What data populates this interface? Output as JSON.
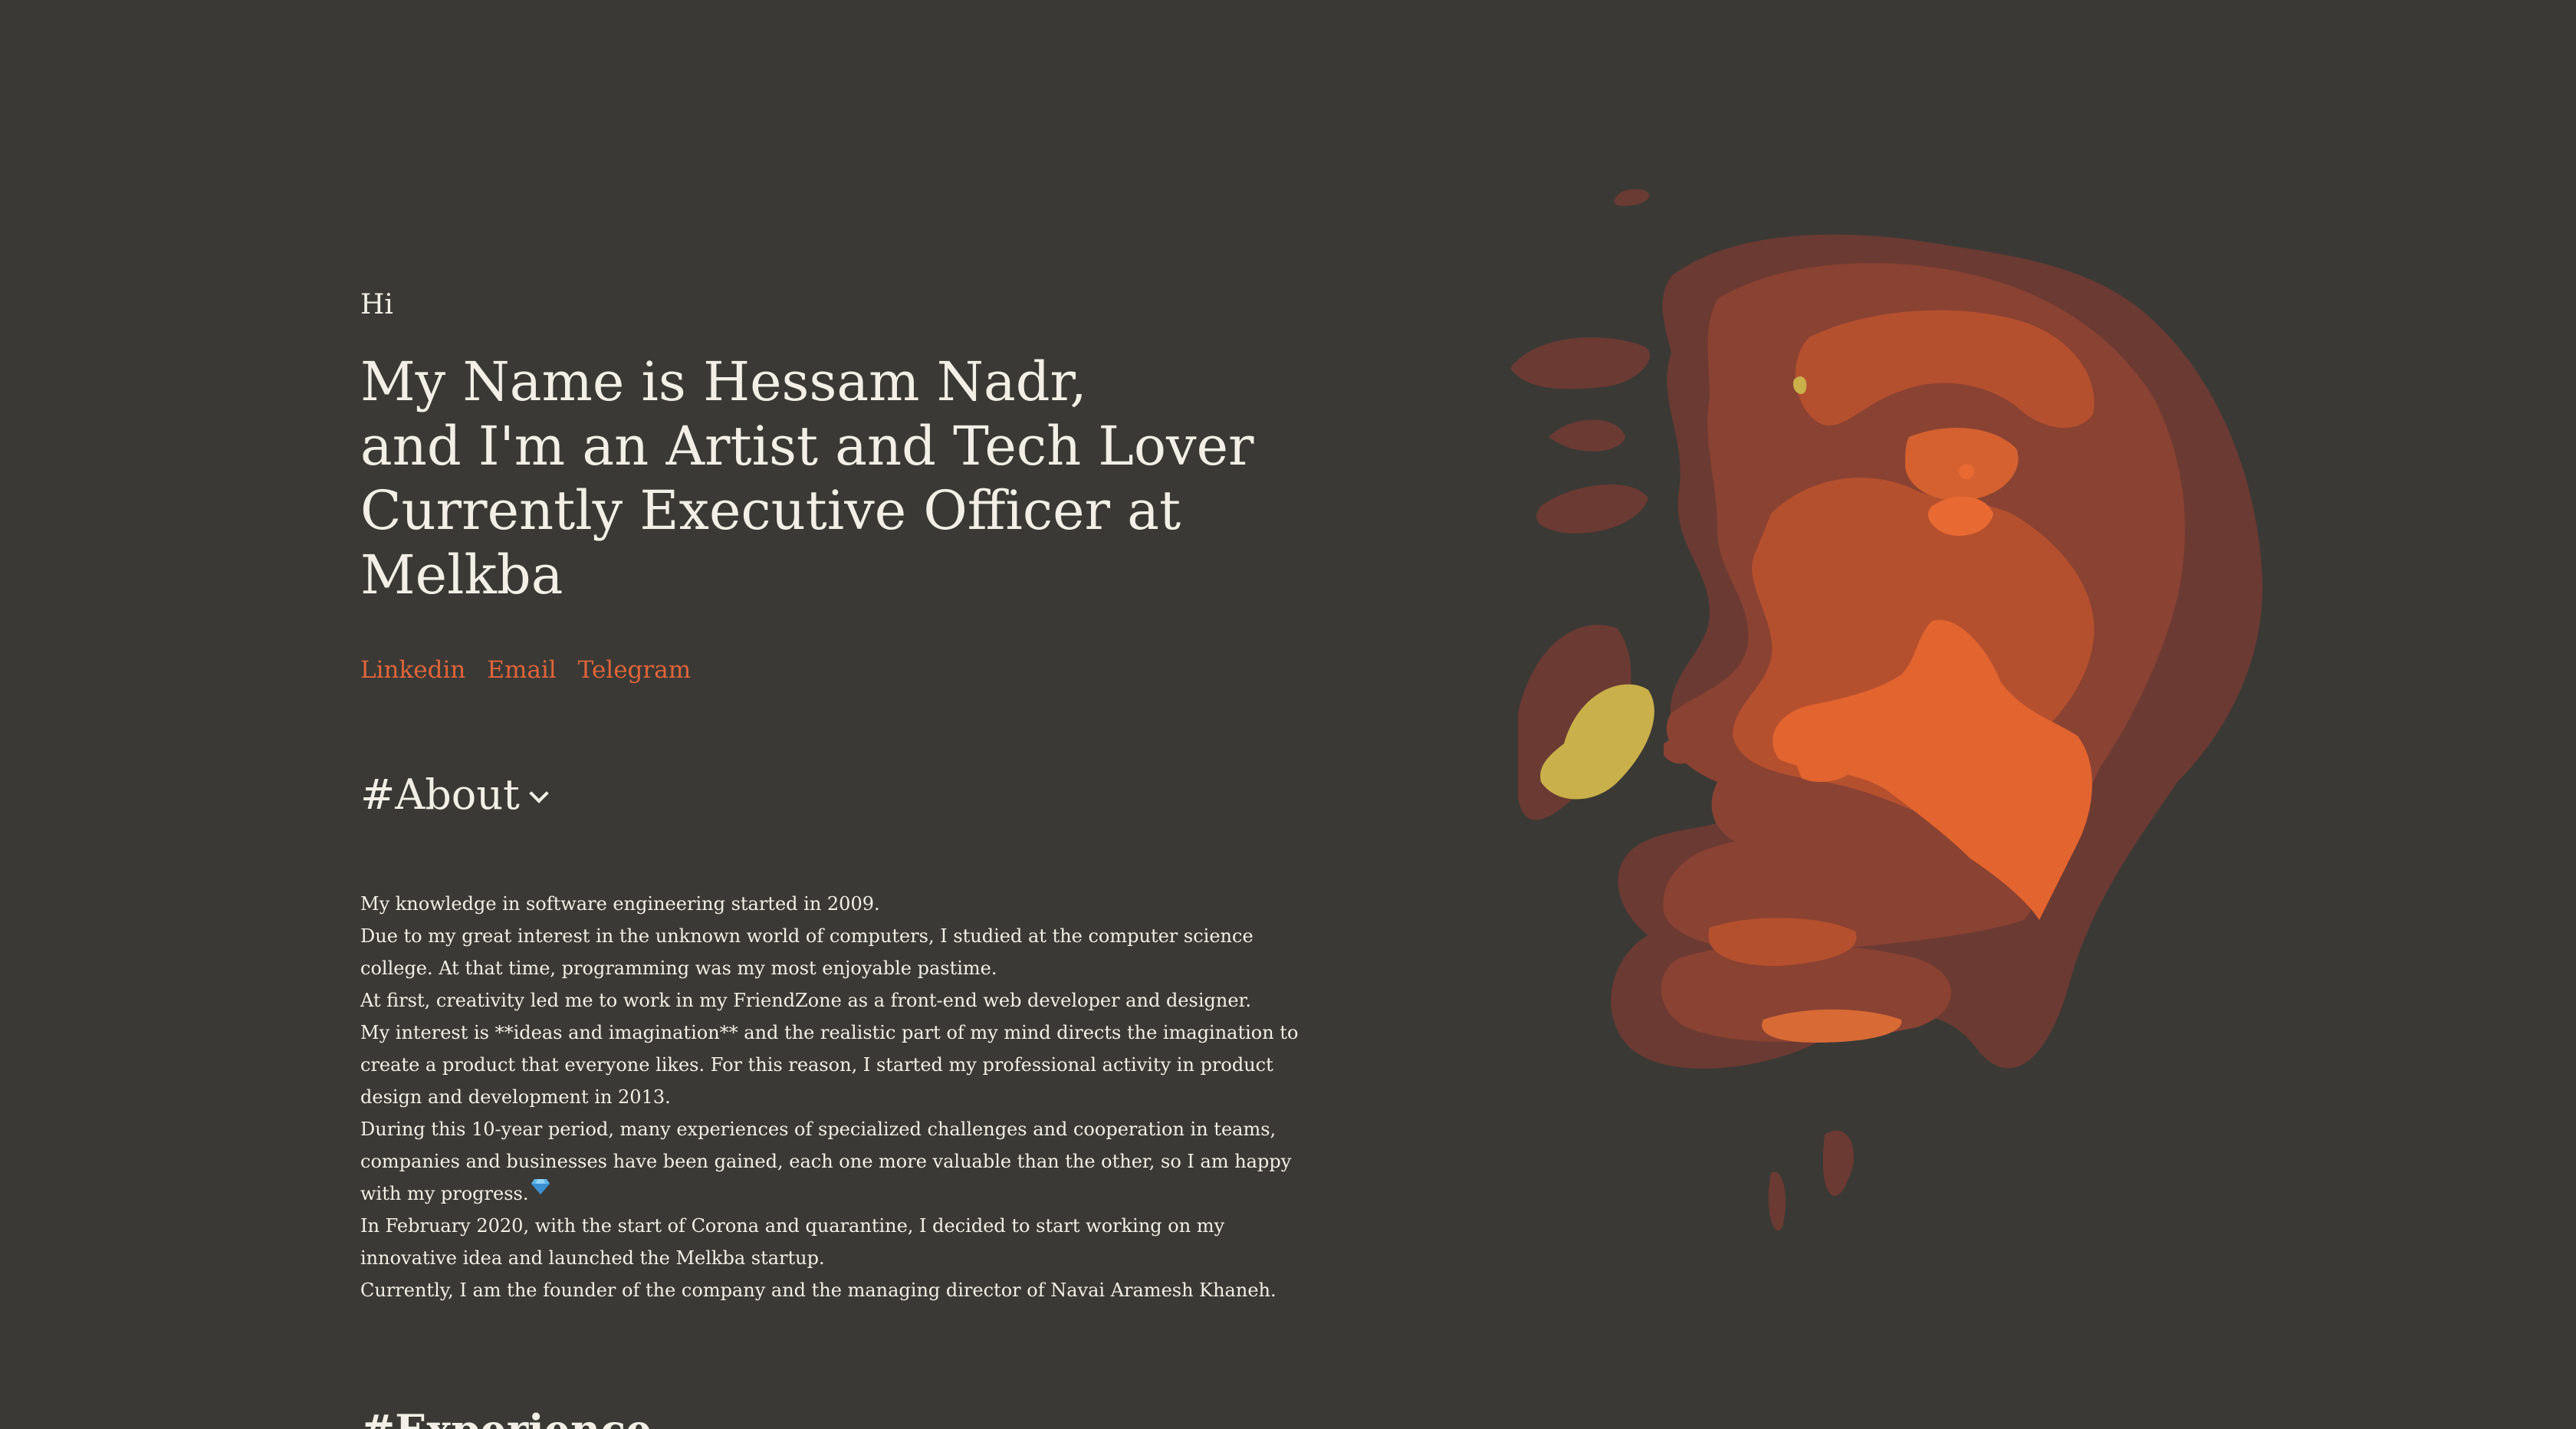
{
  "hero": {
    "greeting": "Hi",
    "headline_lines": [
      "My Name is Hessam Nadr,",
      "and I'm an Artist and Tech Lover",
      "Currently Executive Officer at",
      "Melkba"
    ]
  },
  "links": [
    {
      "label": "Linkedin"
    },
    {
      "label": "Email"
    },
    {
      "label": "Telegram"
    }
  ],
  "about": {
    "title": "#About",
    "paragraphs": [
      "My knowledge in software engineering started in 2009.",
      "Due to my great interest in the unknown world of computers, I studied at the computer science college. At that time, programming was my most enjoyable pastime.",
      "At first, creativity led me to work in my FriendZone as a front-end web developer and designer.",
      "My interest is **ideas and imagination** and the realistic part of my mind directs the imagination to create a product that everyone likes. For this reason, I started my professional activity in product design and development in 2013.",
      "During this 10-year period, many experiences of specialized challenges and cooperation in teams, companies and businesses have been gained, each one more valuable than the other, so I am happy with my progress.",
      "In February 2020, with the start of Corona and quarantine, I decided to start working on my innovative idea and launched the Melkba startup.",
      "Currently, I am the founder of the company and the managing director of Navai Aramesh Khaneh."
    ],
    "emoji_icon": "gem-icon"
  },
  "next_section": {
    "title": "#Experience"
  },
  "colors": {
    "background": "#3a3935",
    "text": "#f3efe6",
    "accent": "#e0653a"
  },
  "icons": [
    "chevron-down-icon",
    "gem-icon"
  ]
}
